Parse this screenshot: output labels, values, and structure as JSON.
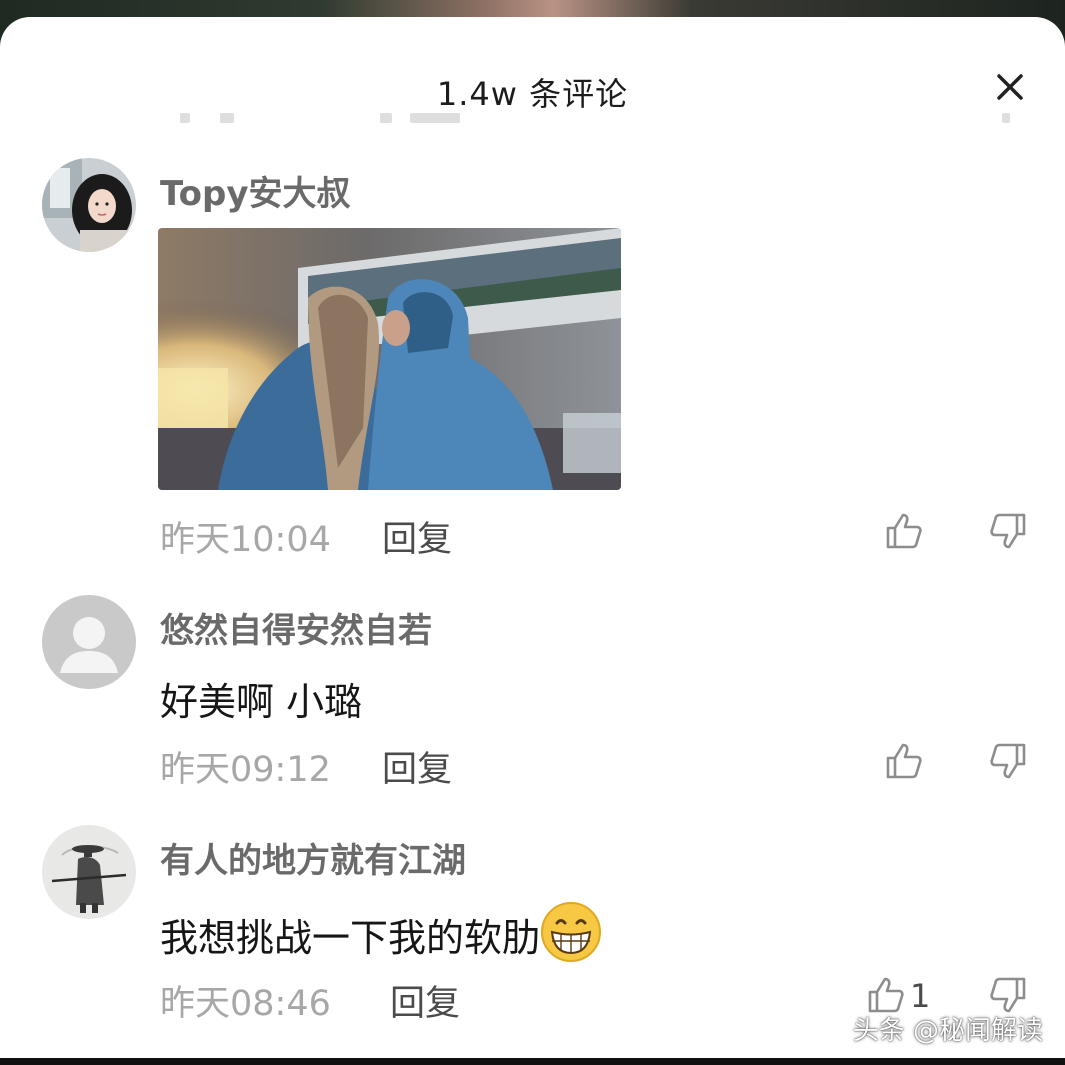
{
  "sheet": {
    "title": "1.4w 条评论",
    "close_icon": "close-icon"
  },
  "comments": [
    {
      "username": "Topy安大叔",
      "avatar": "avatar-photo",
      "text": "",
      "has_image": true,
      "time": "昨天10:04",
      "reply_label": "回复",
      "like_count": ""
    },
    {
      "username": "悠然自得安然自若",
      "avatar": "default-avatar",
      "text": "好美啊 小璐",
      "time": "昨天09:12",
      "reply_label": "回复",
      "like_count": ""
    },
    {
      "username": "有人的地方就有江湖",
      "avatar": "ink-painting-avatar",
      "text": "我想挑战一下我的软肋",
      "emoji": "grinning-face-emoji",
      "time": "昨天08:46",
      "reply_label": "回复",
      "like_count": "1"
    }
  ],
  "watermark": "头条 @秘闻解读",
  "colors": {
    "sheet_bg": "#ffffff",
    "username": "#6a6a6a",
    "body_text": "#161616",
    "timestamp": "#a7a7a7",
    "reply": "#4b4b4b"
  }
}
